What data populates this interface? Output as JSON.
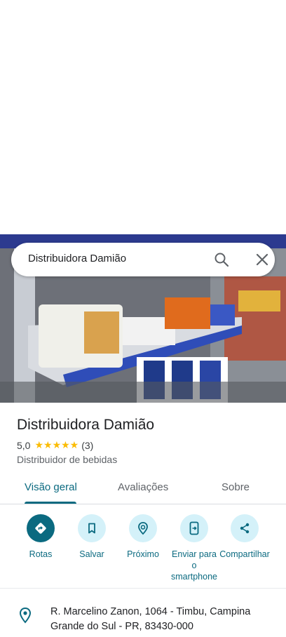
{
  "search": {
    "query": "Distribuidora Damião"
  },
  "place": {
    "name": "Distribuidora Damião",
    "rating": "5,0",
    "stars": "★★★★★",
    "review_count": "(3)",
    "category": "Distribuidor de bebidas"
  },
  "tabs": [
    {
      "label": "Visão geral",
      "active": true
    },
    {
      "label": "Avaliações"
    },
    {
      "label": "Sobre"
    }
  ],
  "actions": [
    {
      "label": "Rotas",
      "icon": "directions-icon"
    },
    {
      "label": "Salvar",
      "icon": "bookmark-icon"
    },
    {
      "label": "Próximo",
      "icon": "nearby-icon"
    },
    {
      "label": "Enviar para o smartphone",
      "icon": "send-to-phone-icon"
    },
    {
      "label": "Compartilhar",
      "icon": "share-icon"
    }
  ],
  "address": "R. Marcelino Zanon, 1064 - Timbu, Campina Grande do Sul - PR, 83430-000",
  "colors": {
    "accent": "#0b6a80",
    "action_bg": "#d4f1f9",
    "star": "#fbbc04"
  }
}
